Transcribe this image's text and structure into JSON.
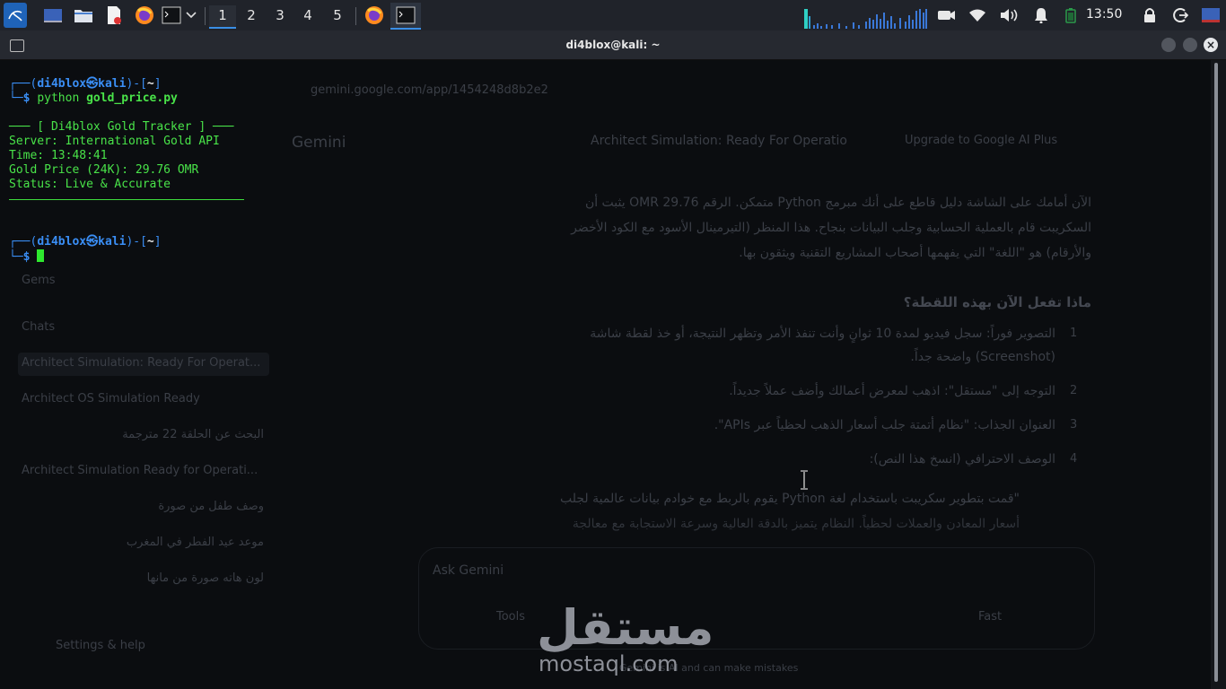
{
  "panel": {
    "workspaces": [
      "1",
      "2",
      "3",
      "4",
      "5"
    ],
    "clock": "13:50"
  },
  "window": {
    "title": "di4blox@kali: ~",
    "close_label": "×"
  },
  "terminal": {
    "prompt1": {
      "corner": "┌──(",
      "user": "di4blox",
      "at": "㉿",
      "host": "kali",
      "mid": ")-[",
      "dir": "~",
      "end": "]"
    },
    "prompt_cont": "└─",
    "dollar": "$",
    "command_name": "python",
    "command_arg": "gold_price.py",
    "output": [
      "─── [ Di4blox Gold Tracker ] ───",
      "Server: International Gold API",
      "Time: 13:48:41",
      "Gold Price (24K): 29.76 OMR",
      "Status: Live & Accurate"
    ],
    "prompt2": {
      "corner": "┌──(",
      "user": "di4blox",
      "at": "㉿",
      "host": "kali",
      "mid": ")-[",
      "dir": "~",
      "end": "]"
    }
  },
  "background_browser": {
    "url": "gemini.google.com/app/1454248d8b2e2",
    "app_name": "Gemini",
    "chat_title": "Architect Simulation: Ready For Operatio",
    "upgrade": "Upgrade to Google AI Plus",
    "sidebar": {
      "gems": "Gems",
      "chats_heading": "Chats",
      "items": [
        "Architect Simulation: Ready For Operat...",
        "Architect OS Simulation Ready",
        "البحث عن الحلقة 22 مترجمة",
        "Architect Simulation Ready for Operati...",
        "وصف طفل من صورة",
        "موعد عيد الفطر في المغرب",
        "لون هاته صورة من مانها"
      ],
      "settings": "Settings & help"
    },
    "content": {
      "p1": "الآن أمامك على الشاشة دليل قاطع على أنك مبرمج Python متمكن. الرقم 29.76 OMR يثبت أن",
      "p2": "السكريبت قام بالعملية الحسابية وجلب البيانات بنجاح. هذا المنظر (التيرمينال الأسود مع الكود الأخضر",
      "p3": "والأرقام) هو \"اللغة\" التي يفهمها أصحاب المشاريع التقنية ويثقون بها.",
      "heading": "ماذا تفعل الآن بهذه اللقطة؟",
      "items": [
        "التصوير فوراً: سجل فيديو لمدة 10 ثوانٍ وأنت تنفذ الأمر وتظهر النتيجة، أو خذ لقطة شاشة",
        "(Screenshot) واضحة جداً.",
        "التوجه إلى \"مستقل\": اذهب لمعرض أعمالك وأضف عملاً جديداً.",
        "العنوان الجذاب: \"نظام أتمتة جلب أسعار الذهب لحظياً عبر APIs\".",
        "الوصف الاحترافي (انسخ هذا النص):"
      ],
      "item_numbers": [
        "1",
        "2",
        "3",
        "4"
      ],
      "quote1": "\"قمت بتطوير سكريبت باستخدام لغة Python يقوم بالربط مع خوادم بيانات عالمية لجلب",
      "quote2": "أسعار المعادن والعملات لحظياً. النظام يتميز بالدقة العالية وسرعة الاستجابة مع معالجة"
    },
    "input_placeholder": "Ask Gemini",
    "tools": "Tools",
    "mode": "Fast",
    "disclaimer": "Gemini is AI and can make mistakes"
  },
  "watermark": {
    "arabic": "مستقل",
    "latin": "mostaql.com"
  },
  "colors": {
    "prompt_blue": "#3a8ef5",
    "terminal_green": "#49e349",
    "panel_bg": "#20232a",
    "terminal_bg": "#0b0d10"
  }
}
